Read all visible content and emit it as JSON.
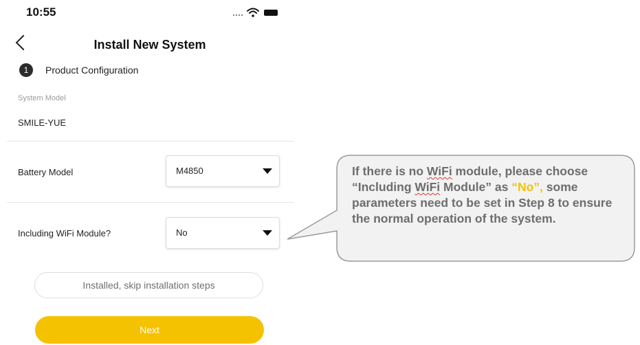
{
  "status_bar": {
    "time": "10:55"
  },
  "header": {
    "title": "Install New System"
  },
  "step": {
    "number": "1",
    "label": "Product Configuration"
  },
  "system_model": {
    "label": "System Model",
    "value": "SMILE-YUE"
  },
  "battery_model": {
    "label": "Battery Model",
    "value": "M4850"
  },
  "wifi_module": {
    "label": "Including WiFi Module?",
    "value": "No"
  },
  "buttons": {
    "skip": "Installed, skip installation steps",
    "next": "Next"
  },
  "callout": {
    "p1": "If there is no ",
    "wifi1": "WiFi",
    "p2": " module, please choose “Including ",
    "wifi2": "WiFi",
    "p3": " Module” as ",
    "highlight": "“No”,",
    "p4": " some parameters need to be set in Step 8 to ensure the normal operation of the system."
  },
  "colors": {
    "accent": "#f4c200",
    "callout_text": "#6d6d6d",
    "callout_fill": "#f2f2f2"
  }
}
